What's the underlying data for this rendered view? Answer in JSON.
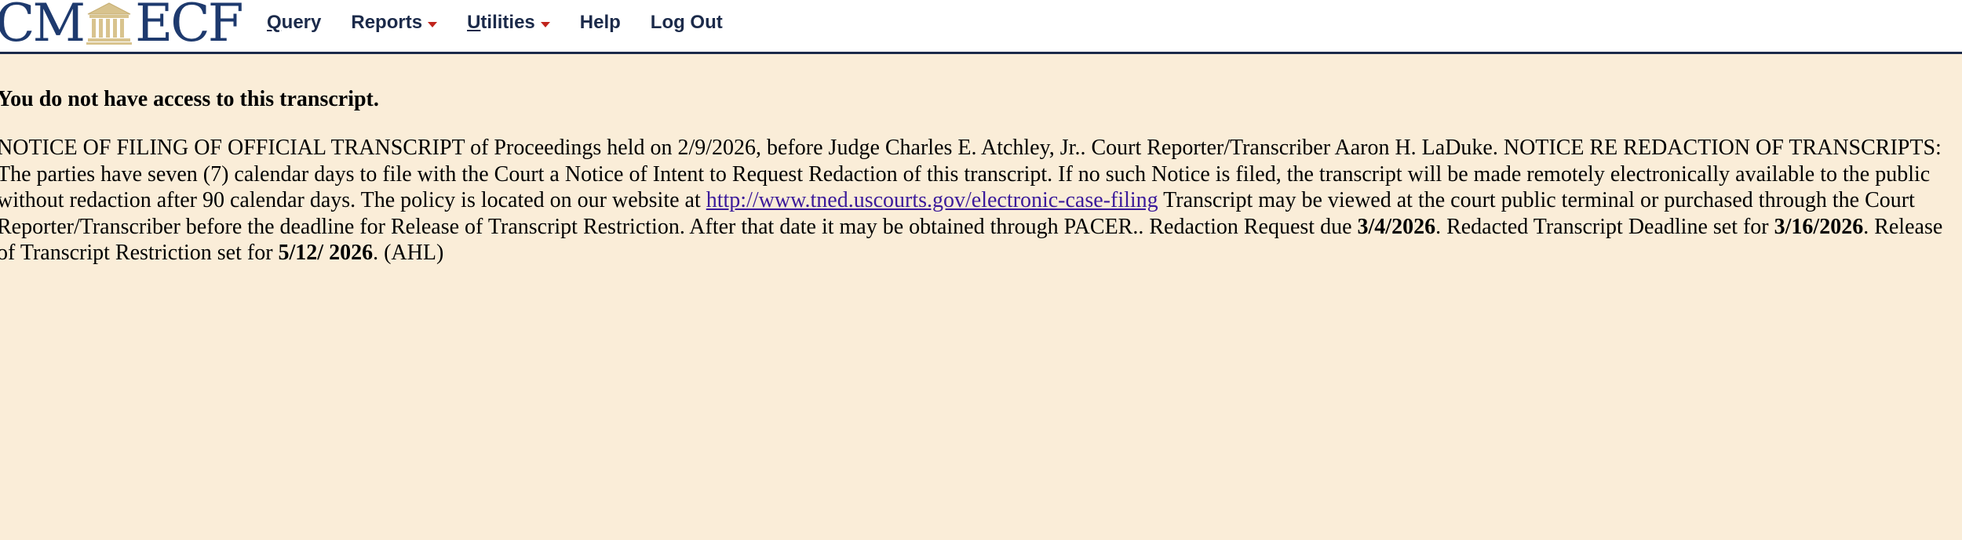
{
  "logo": {
    "left": "CM",
    "right": "ECF"
  },
  "menu": {
    "query_prefix": "Q",
    "query_rest": "uery",
    "reports": "Reports",
    "utilities_prefix": "U",
    "utilities_rest": "tilities",
    "help": "Help",
    "logout": "Log Out"
  },
  "colors": {
    "background": "#faedd8",
    "navy": "#1b2a4a",
    "caret": "#c0241c",
    "link": "#3b1a9a"
  },
  "content": {
    "access_message": "You do not have access to this transcript.",
    "notice_part1": "NOTICE OF FILING OF OFFICIAL TRANSCRIPT of Proceedings held on 2/9/2026, before Judge Charles E. Atchley, Jr.. Court Reporter/Transcriber Aaron H. LaDuke. NOTICE RE REDACTION OF TRANSCRIPTS: The parties have seven (7) calendar days to file with the Court a Notice of Intent to Request Redaction of this transcript. If no such Notice is filed, the transcript will be made remotely electronically available to the public without redaction after 90 calendar days. The policy is located on our website at ",
    "notice_link": "http://www.tned.uscourts.gov/electronic-case-filing",
    "notice_part2": " Transcript may be viewed at the court public terminal or purchased through the Court Reporter/Transcriber before the deadline for Release of Transcript Restriction. After that date it may be obtained through PACER.. Redaction Request due ",
    "redaction_due": "3/4/2026",
    "notice_part3": ". Redacted Transcript Deadline set for ",
    "redacted_deadline": "3/16/2026",
    "notice_part4": ". Release of Transcript Restriction set for ",
    "release_date": "5/12/ 2026",
    "notice_part5": ". (AHL)"
  }
}
